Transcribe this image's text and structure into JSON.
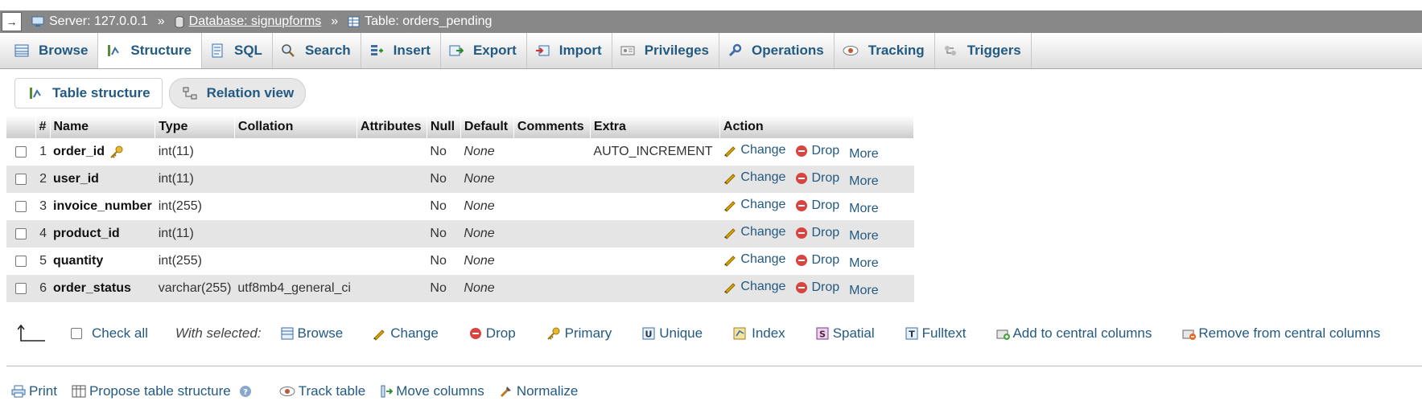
{
  "breadcrumb": {
    "server": "Server: 127.0.0.1",
    "database": "Database: signupforms",
    "table": "Table: orders_pending",
    "separator": "»"
  },
  "tabs": [
    {
      "label": "Browse",
      "icon": "browse-icon"
    },
    {
      "label": "Structure",
      "icon": "structure-icon",
      "active": true
    },
    {
      "label": "SQL",
      "icon": "sql-icon"
    },
    {
      "label": "Search",
      "icon": "search-icon"
    },
    {
      "label": "Insert",
      "icon": "insert-icon"
    },
    {
      "label": "Export",
      "icon": "export-icon"
    },
    {
      "label": "Import",
      "icon": "import-icon"
    },
    {
      "label": "Privileges",
      "icon": "privileges-icon"
    },
    {
      "label": "Operations",
      "icon": "wrench-icon"
    },
    {
      "label": "Tracking",
      "icon": "eye-icon"
    },
    {
      "label": "Triggers",
      "icon": "triggers-icon"
    }
  ],
  "subtabs": {
    "table_structure": "Table structure",
    "relation_view": "Relation view"
  },
  "columns": [
    "#",
    "Name",
    "Type",
    "Collation",
    "Attributes",
    "Null",
    "Default",
    "Comments",
    "Extra",
    "Action"
  ],
  "rows": [
    {
      "num": "1",
      "name": "order_id",
      "type": "int(11)",
      "collation": "",
      "attributes": "",
      "null": "No",
      "default": "None",
      "comments": "",
      "extra": "AUTO_INCREMENT",
      "primary_key": true
    },
    {
      "num": "2",
      "name": "user_id",
      "type": "int(11)",
      "collation": "",
      "attributes": "",
      "null": "No",
      "default": "None",
      "comments": "",
      "extra": ""
    },
    {
      "num": "3",
      "name": "invoice_number",
      "type": "int(255)",
      "collation": "",
      "attributes": "",
      "null": "No",
      "default": "None",
      "comments": "",
      "extra": ""
    },
    {
      "num": "4",
      "name": "product_id",
      "type": "int(11)",
      "collation": "",
      "attributes": "",
      "null": "No",
      "default": "None",
      "comments": "",
      "extra": ""
    },
    {
      "num": "5",
      "name": "quantity",
      "type": "int(255)",
      "collation": "",
      "attributes": "",
      "null": "No",
      "default": "None",
      "comments": "",
      "extra": ""
    },
    {
      "num": "6",
      "name": "order_status",
      "type": "varchar(255)",
      "collation": "utf8mb4_general_ci",
      "attributes": "",
      "null": "No",
      "default": "None",
      "comments": "",
      "extra": ""
    }
  ],
  "row_actions": {
    "change": "Change",
    "drop": "Drop",
    "more": "More"
  },
  "bulk": {
    "check_all": "Check all",
    "with_selected": "With selected:",
    "browse": "Browse",
    "change": "Change",
    "drop": "Drop",
    "primary": "Primary",
    "unique": "Unique",
    "index": "Index",
    "spatial": "Spatial",
    "fulltext": "Fulltext",
    "add_central": "Add to central columns",
    "remove_central": "Remove from central columns"
  },
  "footer": {
    "print": "Print",
    "propose": "Propose table structure",
    "track": "Track table",
    "move": "Move columns",
    "normalize": "Normalize"
  },
  "colors": {
    "link": "#235a81",
    "topbar": "#888888",
    "row_alt": "#e5e5e5",
    "drop_red": "#d9443f",
    "pencil": "#e0a800"
  }
}
